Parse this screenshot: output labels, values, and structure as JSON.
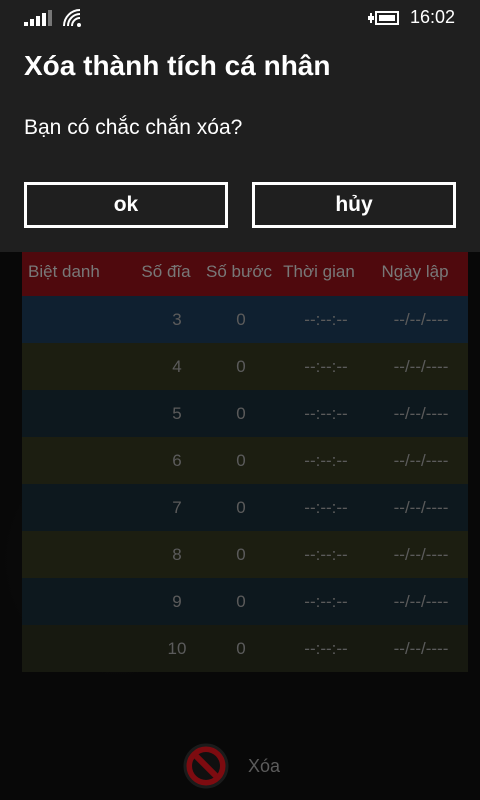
{
  "status_bar": {
    "time": "16:02"
  },
  "dialog": {
    "title": "Xóa thành tích cá nhân",
    "message": "Bạn có chắc chắn xóa?",
    "ok_label": "ok",
    "cancel_label": "hủy"
  },
  "table": {
    "headers": [
      "Biệt danh",
      "Số đĩa",
      "Số bước",
      "Thời gian",
      "Ngày lập"
    ],
    "rows": [
      {
        "name": "",
        "disks": "3",
        "steps": "0",
        "time": "--:--:--",
        "date": "--/--/----"
      },
      {
        "name": "",
        "disks": "4",
        "steps": "0",
        "time": "--:--:--",
        "date": "--/--/----"
      },
      {
        "name": "",
        "disks": "5",
        "steps": "0",
        "time": "--:--:--",
        "date": "--/--/----"
      },
      {
        "name": "",
        "disks": "6",
        "steps": "0",
        "time": "--:--:--",
        "date": "--/--/----"
      },
      {
        "name": "",
        "disks": "7",
        "steps": "0",
        "time": "--:--:--",
        "date": "--/--/----"
      },
      {
        "name": "",
        "disks": "8",
        "steps": "0",
        "time": "--:--:--",
        "date": "--/--/----"
      },
      {
        "name": "",
        "disks": "9",
        "steps": "0",
        "time": "--:--:--",
        "date": "--/--/----"
      },
      {
        "name": "",
        "disks": "10",
        "steps": "0",
        "time": "--:--:--",
        "date": "--/--/----"
      }
    ]
  },
  "app_bar": {
    "delete_label": "Xóa",
    "delete_icon": "no-entry-icon"
  },
  "colors": {
    "header_red": "#7a0f14",
    "dialog_bg": "#1f1f1f",
    "delete_red": "#c0121a"
  }
}
